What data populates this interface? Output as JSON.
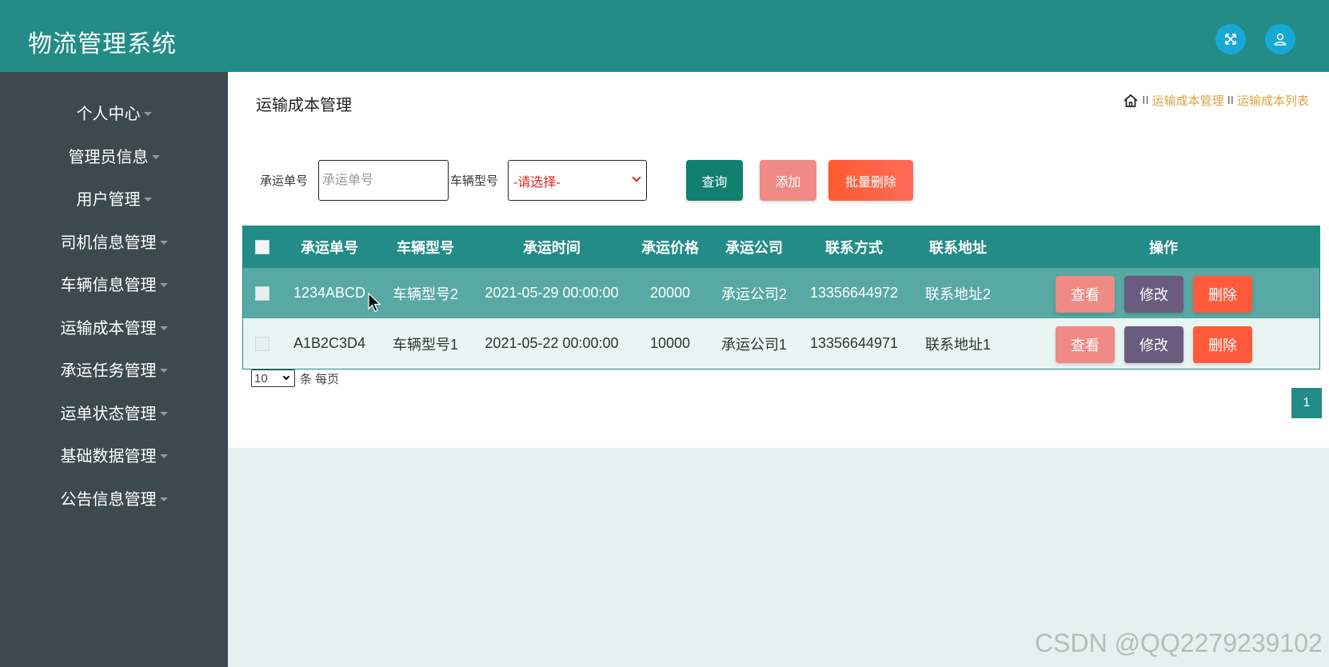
{
  "app": {
    "title": "物流管理系统"
  },
  "header": {
    "fullscreen_icon": "expand-arrows-icon",
    "user_icon": "user-icon",
    "accent": "#17a9d6",
    "bg": "#238c87"
  },
  "sidebar": {
    "items": [
      {
        "label": "个人中心"
      },
      {
        "label": "管理员信息"
      },
      {
        "label": "用户管理"
      },
      {
        "label": "司机信息管理"
      },
      {
        "label": "车辆信息管理"
      },
      {
        "label": "运输成本管理"
      },
      {
        "label": "承运任务管理"
      },
      {
        "label": "运单状态管理"
      },
      {
        "label": "基础数据管理"
      },
      {
        "label": "公告信息管理"
      }
    ]
  },
  "page": {
    "title": "运输成本管理",
    "breadcrumb": {
      "home_icon": "home-icon",
      "sep": "II",
      "level1": "运输成本管理",
      "level2": "运输成本列表"
    }
  },
  "search": {
    "order_label": "承运单号",
    "order_placeholder": "承运单号",
    "vehicle_label": "车辆型号",
    "vehicle_selected": "-请选择-",
    "query_button": "查询",
    "add_button": "添加",
    "batch_delete_button": "批量删除"
  },
  "table": {
    "headers": {
      "order_no": "承运单号",
      "vehicle": "车辆型号",
      "time": "承运时间",
      "price": "承运价格",
      "company": "承运公司",
      "phone": "联系方式",
      "address": "联系地址",
      "actions": "操作"
    },
    "rows": [
      {
        "order_no": "1234ABCD",
        "vehicle": "车辆型号2",
        "time": "2021-05-29 00:00:00",
        "price": "20000",
        "company": "承运公司2",
        "phone": "13356644972",
        "address": "联系地址2"
      },
      {
        "order_no": "A1B2C3D4",
        "vehicle": "车辆型号1",
        "time": "2021-05-22 00:00:00",
        "price": "10000",
        "company": "承运公司1",
        "phone": "13356644971",
        "address": "联系地址1"
      }
    ],
    "view_label": "查看",
    "edit_label": "修改",
    "delete_label": "删除"
  },
  "pagination": {
    "page_size": "10",
    "per_page_text": "条 每页",
    "current_page": "1"
  },
  "watermark": "CSDN @QQ2279239102",
  "colors": {
    "primary": "#238c87",
    "sidebar_bg": "#3c4a4f",
    "view": "#f08a84",
    "edit": "#6b5b7e",
    "delete": "#ff5a3c",
    "breadcrumb": "#d9a441"
  }
}
